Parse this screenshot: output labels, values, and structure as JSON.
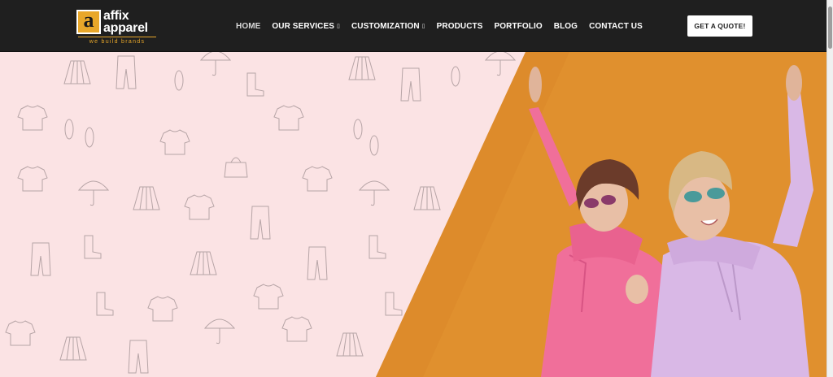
{
  "brand": {
    "logo_mark": "a",
    "line1": "affix",
    "line2": "apparel",
    "tagline": "we build brands"
  },
  "nav": {
    "items": [
      {
        "label": "HOME",
        "active": true,
        "dropdown": false
      },
      {
        "label": "OUR SERVICES",
        "active": false,
        "dropdown": true
      },
      {
        "label": "CUSTOMIZATION",
        "active": false,
        "dropdown": true
      },
      {
        "label": "PRODUCTS",
        "active": false,
        "dropdown": false
      },
      {
        "label": "PORTFOLIO",
        "active": false,
        "dropdown": false
      },
      {
        "label": "BLOG",
        "active": false,
        "dropdown": false
      },
      {
        "label": "CONTACT US",
        "active": false,
        "dropdown": false
      }
    ],
    "caret_glyph": "▯"
  },
  "cta": {
    "label": "GET A QUOTE!"
  },
  "colors": {
    "header_bg": "#1f1f1f",
    "brand_accent": "#e8a72a",
    "hero_left_bg": "#fbe3e4",
    "hero_right_bg": "#e0902e",
    "hoodie_pink": "#f06f9a",
    "hoodie_lilac": "#d9b8e6"
  }
}
